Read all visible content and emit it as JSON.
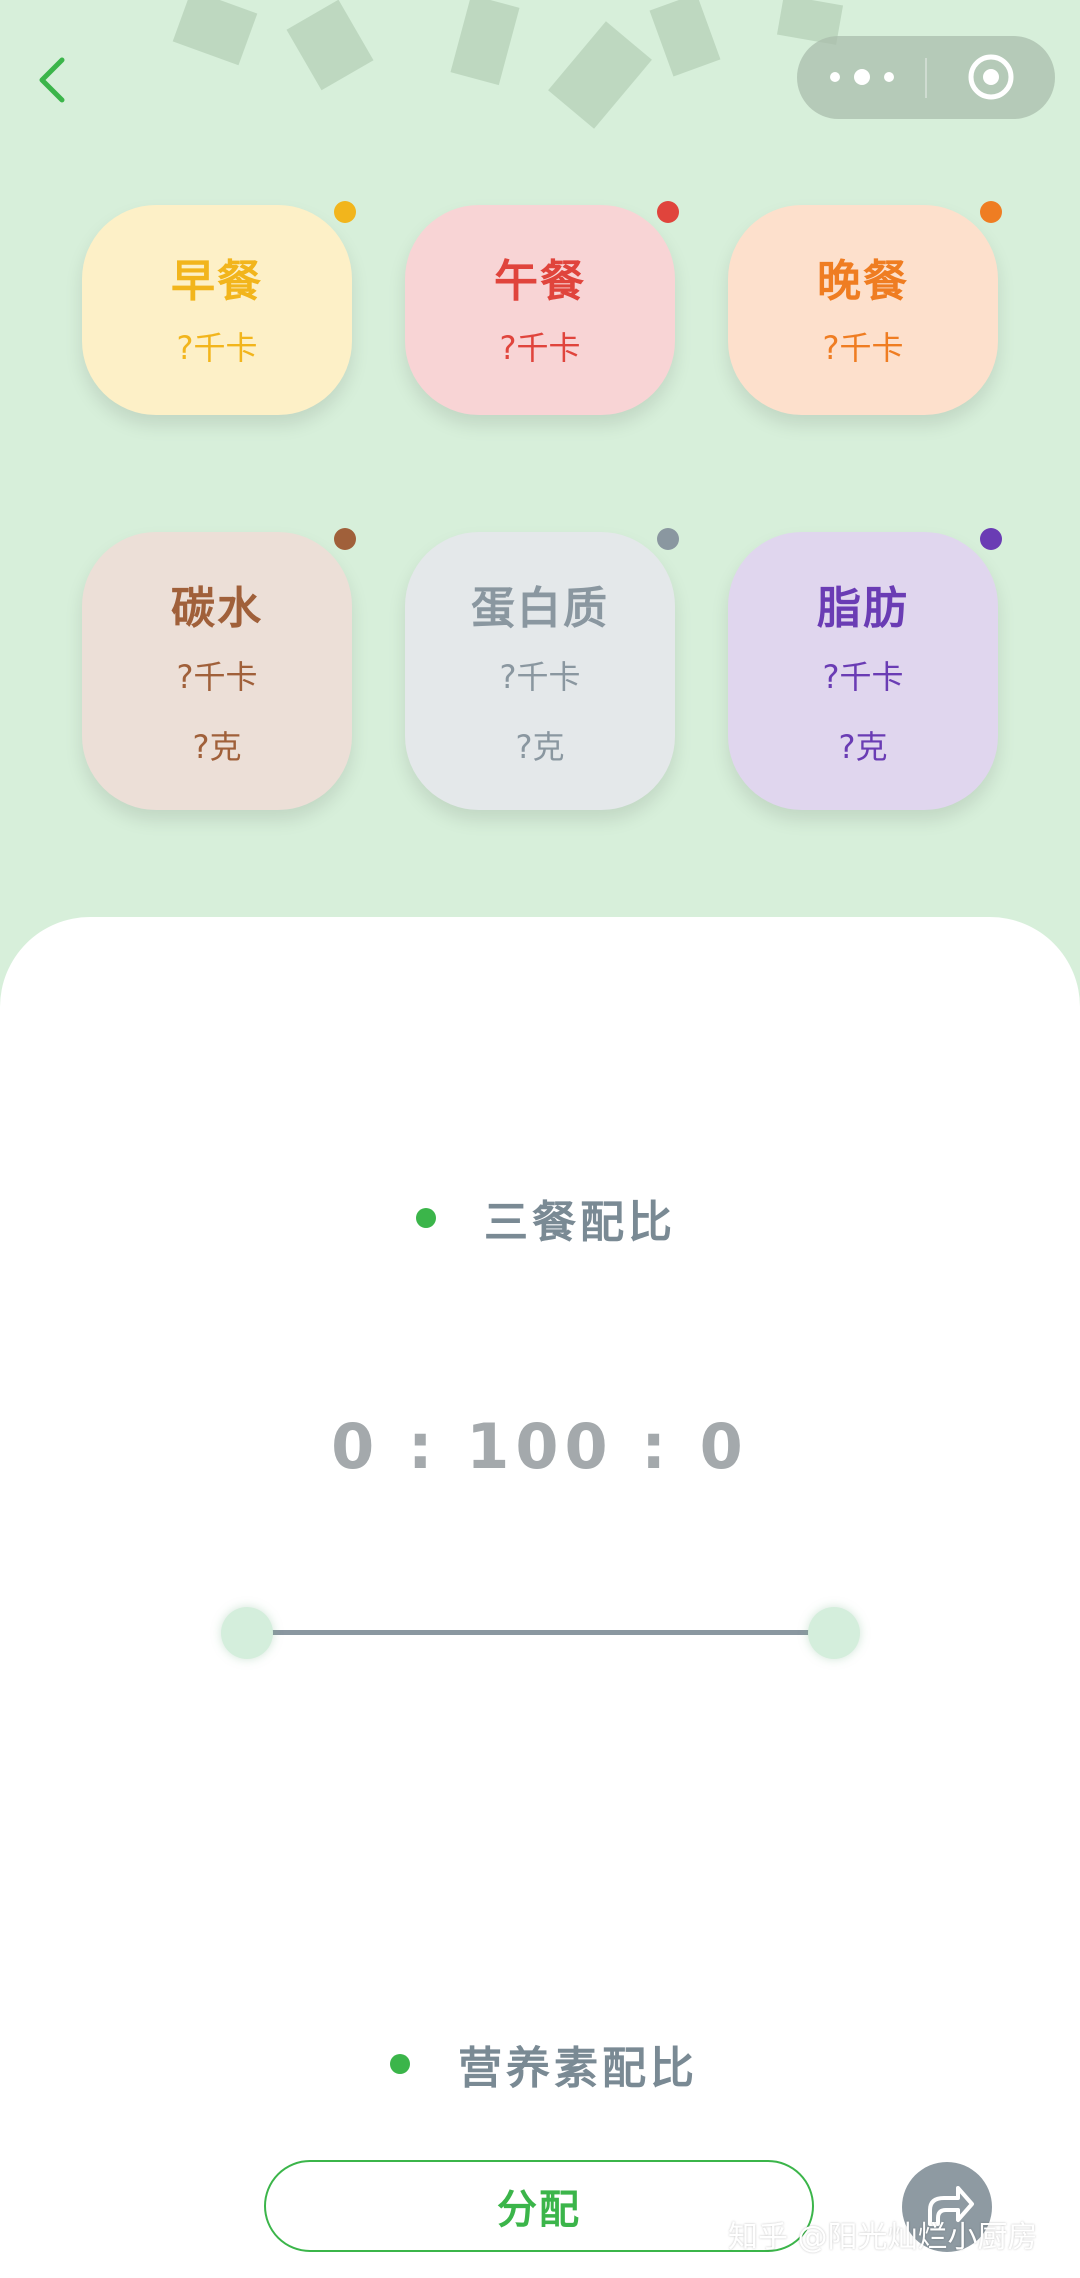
{
  "colors": {
    "accent": "#3bb54a",
    "breakfast": "#f2b51c",
    "lunch": "#e0443c",
    "dinner": "#ef7d22",
    "carb": "#a0603a",
    "protein": "#8a97a0",
    "fat": "#6a3cb4"
  },
  "icons": {
    "back": "chevron-left-icon",
    "more": "more-dots-icon",
    "close": "target-circle-icon",
    "share": "share-icon"
  },
  "meals": [
    {
      "title": "早餐",
      "kcal": "?千卡"
    },
    {
      "title": "午餐",
      "kcal": "?千卡"
    },
    {
      "title": "晚餐",
      "kcal": "?千卡"
    }
  ],
  "nutrients": [
    {
      "title": "碳水",
      "kcal": "?千卡",
      "gram": "?克"
    },
    {
      "title": "蛋白质",
      "kcal": "?千卡",
      "gram": "?克"
    },
    {
      "title": "脂肪",
      "kcal": "?千卡",
      "gram": "?克"
    }
  ],
  "meal_ratio": {
    "header": "三餐配比",
    "value": "0 : 100 : 0"
  },
  "nutrient_ratio": {
    "header": "营养素配比"
  },
  "distribute_button": "分配",
  "watermark": "知乎 @阳光灿烂小厨房"
}
